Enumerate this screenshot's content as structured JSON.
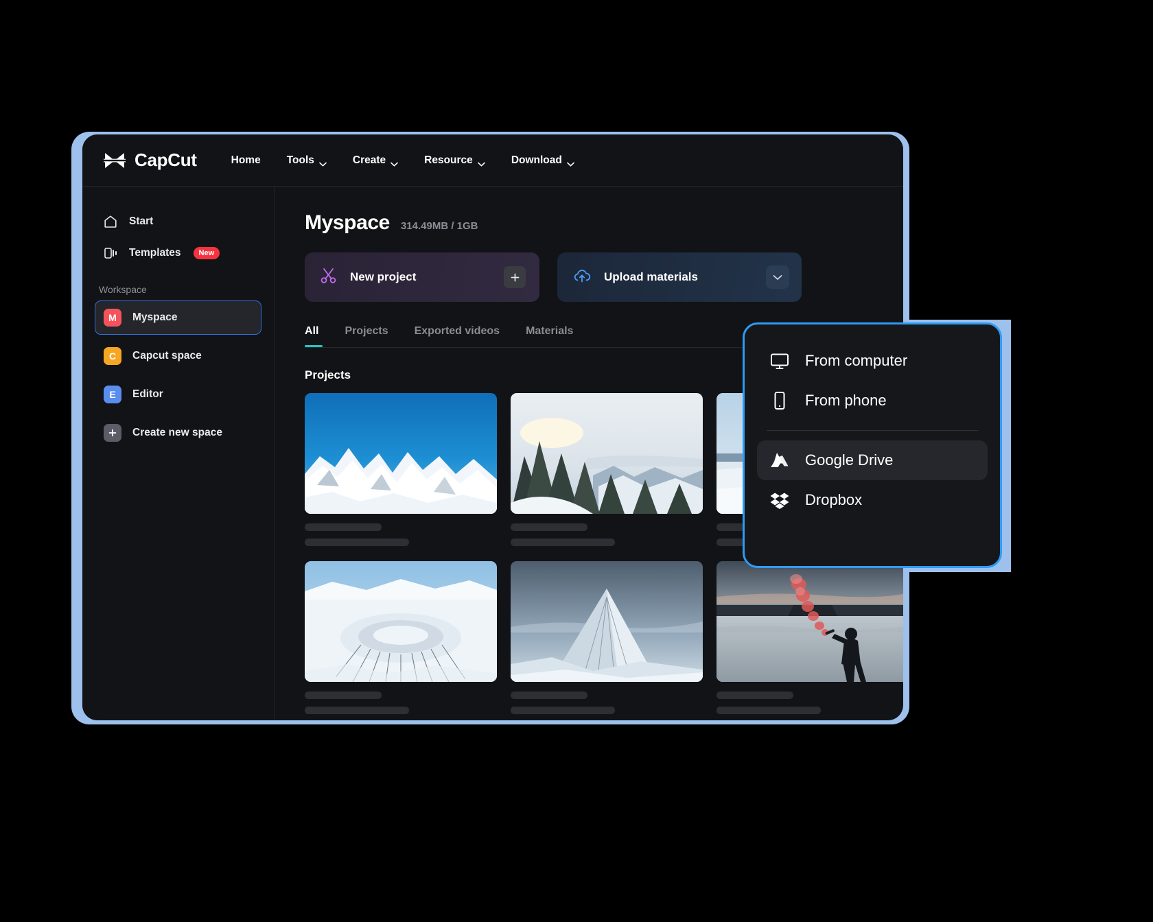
{
  "navbar": {
    "brand": "CapCut",
    "brand_icon": "capcut-logo-icon",
    "items": [
      {
        "label": "Home",
        "caret": false
      },
      {
        "label": "Tools",
        "caret": true
      },
      {
        "label": "Create",
        "caret": true
      },
      {
        "label": "Resource",
        "caret": true
      },
      {
        "label": "Download",
        "caret": true
      }
    ]
  },
  "sidebar": {
    "links": [
      {
        "label": "Start",
        "icon": "home-icon",
        "badge": ""
      },
      {
        "label": "Templates",
        "icon": "templates-icon",
        "badge": "New"
      }
    ],
    "section_label": "Workspace",
    "workspaces": [
      {
        "label": "Myspace",
        "initial": "M",
        "color": "#f5535b",
        "active": true
      },
      {
        "label": "Capcut space",
        "initial": "C",
        "color": "#f5a623",
        "active": false
      },
      {
        "label": "Editor",
        "initial": "E",
        "color": "#5b8def",
        "active": false
      }
    ],
    "create_space": {
      "label": "Create new space",
      "icon": "plus-icon",
      "color": "#5a5d66"
    }
  },
  "main": {
    "title": "Myspace",
    "storage": "314.49MB / 1GB",
    "actions": [
      {
        "label": "New project",
        "icon": "scissors-icon",
        "trailing": "plus-icon"
      },
      {
        "label": "Upload materials",
        "icon": "cloud-upload-icon",
        "trailing": "chevron-down-icon"
      }
    ],
    "tabs": [
      {
        "label": "All",
        "active": true
      },
      {
        "label": "Projects",
        "active": false
      },
      {
        "label": "Exported videos",
        "active": false
      },
      {
        "label": "Materials",
        "active": false
      }
    ],
    "section_title": "Projects",
    "projects": [
      {
        "name": "snowy-peaks-blue-sky"
      },
      {
        "name": "snowy-forest-sunrise"
      },
      {
        "name": "arctic-plain"
      },
      {
        "name": "snow-crater-aerial"
      },
      {
        "name": "kirkjufell-mountain"
      },
      {
        "name": "person-with-red-flare"
      }
    ]
  },
  "dropdown": {
    "items": [
      {
        "label": "From computer",
        "icon": "monitor-icon",
        "hover": false
      },
      {
        "label": "From phone",
        "icon": "phone-icon",
        "hover": false
      },
      {
        "label": "Google Drive",
        "icon": "google-drive-icon",
        "hover": true
      },
      {
        "label": "Dropbox",
        "icon": "dropbox-icon",
        "hover": false
      }
    ]
  },
  "colors": {
    "accent_blue": "#2f9bf5",
    "tab_underline": "#26c4c4",
    "badge_red": "#f5333f",
    "window_bg": "#121316",
    "glow": "#9dc0ec"
  }
}
